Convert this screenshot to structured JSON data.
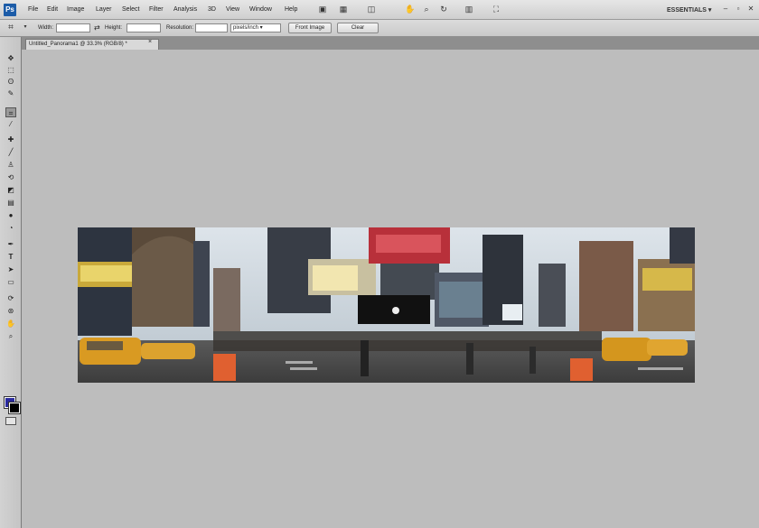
{
  "app": {
    "logo": "Ps"
  },
  "menu": [
    "File",
    "Edit",
    "Image",
    "Layer",
    "Select",
    "Filter",
    "Analysis",
    "3D",
    "View",
    "Window",
    "Help"
  ],
  "toolbar_icons": [
    "bridge-icon",
    "view-extras-icon",
    "zoom-level-icon",
    "arrange-documents-icon",
    "hand-icon",
    "zoom-icon",
    "rotate-view-icon",
    "arrange-icon",
    "screen-mode-icon"
  ],
  "workspace": {
    "label": "ESSENTIALS ▾"
  },
  "window_controls": {
    "minimize": "–",
    "restore": "▫",
    "close": "✕"
  },
  "options_bar": {
    "tool_icon": "crop-tool-icon",
    "width_label": "Width:",
    "width_value": "",
    "swap_label": "⇄",
    "height_label": "Height:",
    "height_value": "",
    "resolution_label": "Resolution:",
    "resolution_value": "",
    "resolution_unit": "pixels/inch",
    "front_image_label": "Front Image",
    "clear_label": "Clear"
  },
  "document": {
    "tab_title": "Untitled_Panorama1 @ 33.3% (RGB/8) *",
    "close_label": "×"
  },
  "tools": [
    "move-tool",
    "marquee-tool",
    "lasso-tool",
    "quick-selection-tool",
    "crop-tool",
    "eyedropper-tool",
    "healing-brush-tool",
    "brush-tool",
    "clone-stamp-tool",
    "history-brush-tool",
    "eraser-tool",
    "gradient-tool",
    "blur-tool",
    "dodge-tool",
    "pen-tool",
    "type-tool",
    "path-selection-tool",
    "rectangle-tool",
    "3d-rotate-tool",
    "3d-orbit-tool",
    "hand-tool",
    "zoom-tool"
  ],
  "colors": {
    "foreground": "#2a2a9e",
    "background": "#000000"
  },
  "canvas": {
    "content": "panorama-image"
  }
}
